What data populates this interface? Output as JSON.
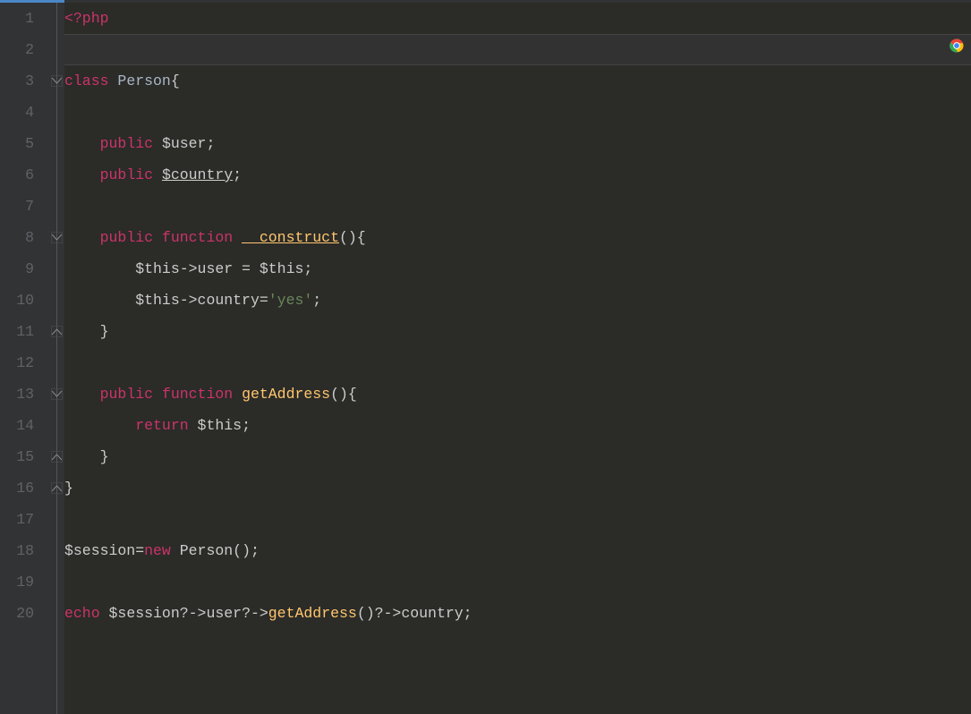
{
  "lines": {
    "count": 20,
    "numbers": [
      "1",
      "2",
      "3",
      "4",
      "5",
      "6",
      "7",
      "8",
      "9",
      "10",
      "11",
      "12",
      "13",
      "14",
      "15",
      "16",
      "17",
      "18",
      "19",
      "20"
    ]
  },
  "code": {
    "l1": {
      "open_tag": "<?php"
    },
    "l3": {
      "kw_class": "class",
      "name": "Person",
      "brace": "{"
    },
    "l5": {
      "kw_public": "public",
      "var": "$user",
      "semi": ";"
    },
    "l6": {
      "kw_public": "public",
      "var": "$country",
      "semi": ";"
    },
    "l8": {
      "kw_public": "public",
      "kw_function": "function",
      "name": "__construct",
      "parens": "()",
      "brace": "{"
    },
    "l9": {
      "this": "$this",
      "arrow1": "->",
      "prop1": "user",
      "eq": " = ",
      "this2": "$this",
      "semi": ";"
    },
    "l10": {
      "this": "$this",
      "arrow1": "->",
      "prop1": "country",
      "eq": "=",
      "str": "'yes'",
      "semi": ";"
    },
    "l11": {
      "brace": "}"
    },
    "l13": {
      "kw_public": "public",
      "kw_function": "function",
      "name": "getAddress",
      "parens": "()",
      "brace": "{"
    },
    "l14": {
      "kw_return": "return",
      "this": "$this",
      "semi": ";"
    },
    "l15": {
      "brace": "}"
    },
    "l16": {
      "brace": "}"
    },
    "l18": {
      "var": "$session",
      "eq": "=",
      "kw_new": "new",
      "name": "Person",
      "parens": "()",
      "semi": ";"
    },
    "l20": {
      "kw_echo": "echo",
      "var": "$session",
      "q1": "?->",
      "prop1": "user",
      "q2": "?->",
      "method": "getAddress",
      "parens": "()",
      "q3": "?->",
      "prop2": "country",
      "semi": ";"
    }
  },
  "fold_markers": [
    {
      "line": 3,
      "type": "open"
    },
    {
      "line": 8,
      "type": "open"
    },
    {
      "line": 11,
      "type": "close"
    },
    {
      "line": 13,
      "type": "open"
    },
    {
      "line": 15,
      "type": "close"
    },
    {
      "line": 16,
      "type": "close"
    }
  ],
  "highlighted_line": 2
}
